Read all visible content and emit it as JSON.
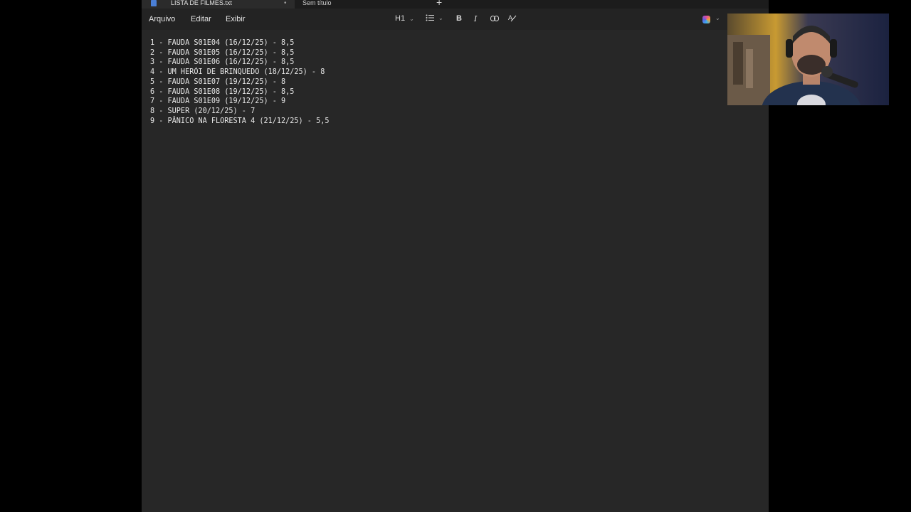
{
  "tabs": [
    {
      "label": "LISTA DE FILMES.txt",
      "active": true,
      "unsaved_indicator": "•"
    },
    {
      "label": "Sem título",
      "active": false
    }
  ],
  "add_tab_label": "+",
  "menu": {
    "file": "Arquivo",
    "edit": "Editar",
    "view": "Exibir"
  },
  "toolbar": {
    "heading_label": "H1",
    "heading_chevron": "⌄",
    "list_icon": "list-icon",
    "list_chevron": "⌄",
    "bold_label": "B",
    "italic_label": "I",
    "link_icon": "link-icon",
    "clear_format_icon": "clear-formatting-icon",
    "copilot_icon": "copilot-icon",
    "copilot_chevron": "⌄"
  },
  "document": {
    "lines": [
      "1 - FAUDA S01E04 (16/12/25) - 8,5",
      "2 - FAUDA S01E05 (16/12/25) - 8,5",
      "3 - FAUDA S01E06 (16/12/25) - 8,5",
      "4 - UM HERÓI DE BRINQUEDO (18/12/25) - 8",
      "5 - FAUDA S01E07 (19/12/25) - 8",
      "6 - FAUDA S01E08 (19/12/25) - 8,5",
      "7 - FAUDA S01E09 (19/12/25) - 9",
      "8 - SUPER (20/12/25) - 7",
      "9 - PÂNICO NA FLORESTA 4 (21/12/25) - 5,5"
    ]
  },
  "colors": {
    "background": "#000000",
    "window": "#272727",
    "text": "#e8e8e8",
    "accent_blue": "#4a7fd6"
  }
}
